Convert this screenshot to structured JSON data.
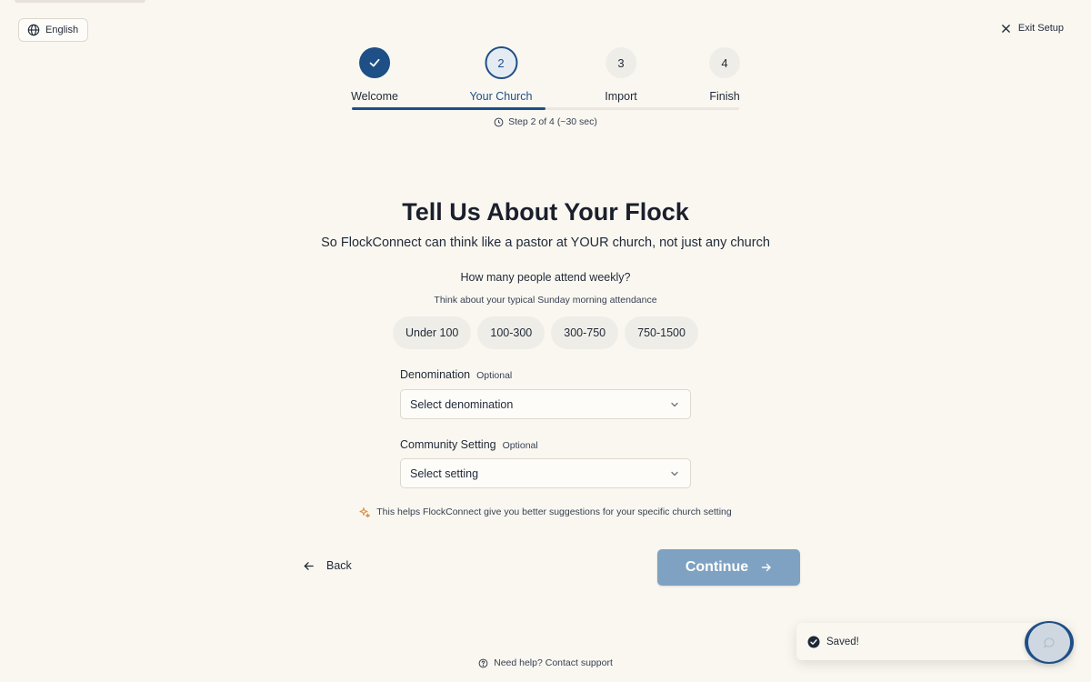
{
  "header": {
    "language_label": "English",
    "exit_label": "Exit Setup"
  },
  "stepper": {
    "steps": [
      {
        "number": "1",
        "label": "Welcome",
        "status": "done"
      },
      {
        "number": "2",
        "label": "Your Church",
        "status": "active"
      },
      {
        "number": "3",
        "label": "Import",
        "status": "upcoming"
      },
      {
        "number": "4",
        "label": "Finish",
        "status": "upcoming"
      }
    ],
    "progress_fraction": 0.5,
    "meta": "Step 2 of 4 (~30 sec)"
  },
  "main": {
    "title": "Tell Us About Your Flock",
    "subtitle": "So FlockConnect can think like a pastor at YOUR church, not just any church",
    "attendance": {
      "question": "How many people attend weekly?",
      "hint": "Think about your typical Sunday morning attendance",
      "options": [
        "Under 100",
        "100-300",
        "300-750",
        "750-1500"
      ]
    },
    "denomination": {
      "label": "Denomination",
      "optional": "Optional",
      "placeholder": "Select denomination"
    },
    "community": {
      "label": "Community Setting",
      "optional": "Optional",
      "placeholder": "Select setting"
    },
    "helper_text": "This helps FlockConnect give you better suggestions for your specific church setting"
  },
  "footer": {
    "back_label": "Back",
    "continue_label": "Continue",
    "support_text": "Need help? Contact support"
  },
  "toast": {
    "message": "Saved!"
  },
  "colors": {
    "primary": "#1e4f86",
    "continue_disabled": "#7fa2c2",
    "background": "#faf7f1"
  }
}
